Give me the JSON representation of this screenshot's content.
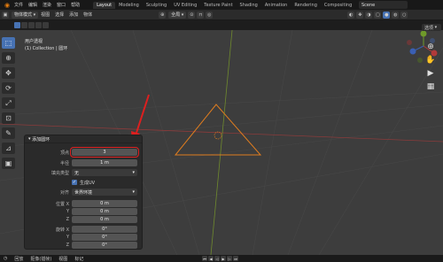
{
  "topbar": {
    "menus": [
      "文件",
      "编辑",
      "渲染",
      "窗口",
      "帮助"
    ],
    "tabs": [
      "Layout",
      "Modeling",
      "Sculpting",
      "UV Editing",
      "Texture Paint",
      "Shading",
      "Animation",
      "Rendering",
      "Compositing"
    ],
    "active_tab": "Layout",
    "scene": "Scene"
  },
  "toolbar": {
    "mode": "物体模式",
    "menus": [
      "视图",
      "选择",
      "添加",
      "物体"
    ],
    "orientation": "全局"
  },
  "options_label": "选项",
  "viewport": {
    "view_name": "用户透视",
    "collection": "(1) Collection | 圆环"
  },
  "operator_panel": {
    "title": "添加圆环",
    "vertices_label": "顶点",
    "vertices": "3",
    "radius_label": "半径",
    "radius": "1 m",
    "fill_type_label": "填充类型",
    "fill_type": "无",
    "generate_uv_label": "生成UV",
    "align_label": "对齐",
    "align": "世界环境",
    "location_label": "位置 X",
    "y_label": "Y",
    "z_label": "Z",
    "location_x": "0 m",
    "location_y": "0 m",
    "location_z": "0 m",
    "rotation_label": "旋转 X",
    "rotation_x": "0°",
    "rotation_y": "0°",
    "rotation_z": "0°"
  },
  "statusbar": {
    "items": [
      "回放",
      "抠像(插帧)",
      "视图",
      "标记"
    ]
  },
  "colors": {
    "accent": "#4772b3",
    "triangle": "#e07d1f",
    "arrow": "#dd1f1f",
    "highlight_box": "#d22222"
  }
}
